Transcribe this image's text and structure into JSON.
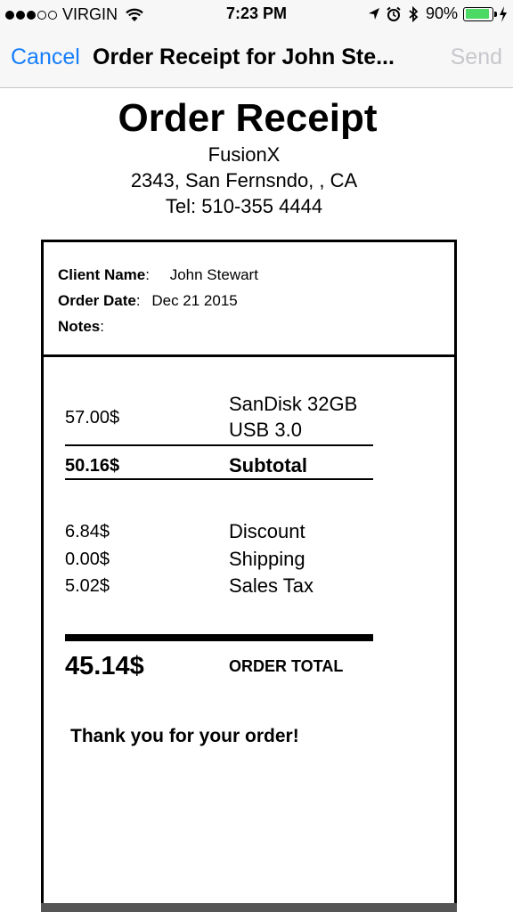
{
  "status_bar": {
    "carrier": "VIRGIN",
    "signal_bars": 3,
    "signal_total": 5,
    "time": "7:23 PM",
    "battery": "90%",
    "battery_level": 0.9,
    "battery_color": "#4cd964",
    "icons": [
      "location-arrow-icon",
      "alarm-clock-icon",
      "bluetooth-icon",
      "charging-bolt-icon"
    ]
  },
  "nav": {
    "cancel": "Cancel",
    "title": "Order Receipt for John Ste...",
    "send": "Send",
    "accent_color": "#147efb",
    "disabled_color": "#c7c7cc"
  },
  "receipt": {
    "title": "Order Receipt",
    "store": "FusionX",
    "address": "2343, San Fernsndo, , CA",
    "phone": "Tel: 510-355 4444",
    "client_label": "Client Name",
    "client_name": "John Stewart",
    "date_label": "Order Date",
    "order_date": "Dec 21 2015",
    "notes_label": "Notes",
    "notes": "",
    "colon": ":",
    "item": {
      "amount": "57.00$",
      "name_line1": "SanDisk 32GB",
      "name_line2": "USB 3.0"
    },
    "subtotal": {
      "amount": "50.16$",
      "label": "Subtotal"
    },
    "adjustments": [
      {
        "amount": "6.84$",
        "label": "Discount"
      },
      {
        "amount": "0.00$",
        "label": "Shipping"
      },
      {
        "amount": "5.02$",
        "label": "Sales Tax"
      }
    ],
    "total": {
      "amount": "45.14$",
      "label": "ORDER TOTAL"
    },
    "thanks": "Thank you for your order!"
  }
}
